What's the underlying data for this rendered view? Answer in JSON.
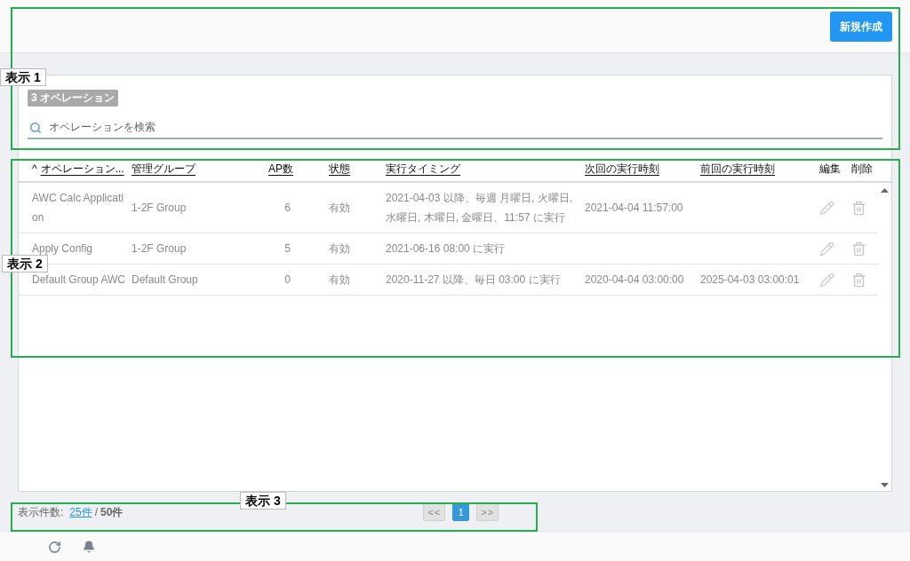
{
  "header": {
    "new_button": "新規作成"
  },
  "operations_panel": {
    "count_badge": "3 オペレーション",
    "search": {
      "placeholder": "オペレーションを検索"
    }
  },
  "table": {
    "columns": [
      {
        "label": "オペレーション...",
        "sortable": true,
        "sort_indicator": "^"
      },
      {
        "label": "管理グループ",
        "sortable": true
      },
      {
        "label": "AP数",
        "sortable": true
      },
      {
        "label": "状態",
        "sortable": true
      },
      {
        "label": "実行タイミング",
        "sortable": true
      },
      {
        "label": "次回の実行時刻",
        "sortable": true
      },
      {
        "label": "前回の実行時刻",
        "sortable": true
      },
      {
        "label": "編集",
        "sortable": false
      },
      {
        "label": "削除",
        "sortable": false
      }
    ],
    "rows": [
      {
        "cells": [
          "AWC Calc Application",
          "1-2F Group",
          "6",
          "有効",
          "2021-04-03 以降、毎週 月曜日, 火曜日, 水曜日, 木曜日, 金曜日、11:57 に実行",
          "2021-04-04 11:57:00",
          ""
        ]
      },
      {
        "cells": [
          "Apply Config",
          "1-2F Group",
          "5",
          "有効",
          "2021-06-16 08:00 に実行",
          "",
          ""
        ]
      },
      {
        "cells": [
          "Default Group AWC",
          "Default Group",
          "0",
          "有効",
          "2020-11-27 以降、毎日 03:00 に実行",
          "2020-04-04 03:00:00",
          "2025-04-03 03:00:01"
        ]
      }
    ]
  },
  "footer": {
    "page_size_label": "表示件数:",
    "page_size": "25件",
    "separator": "/",
    "total": "50件",
    "pagination": [
      {
        "label": "<<",
        "kind": "nav",
        "selected": false
      },
      {
        "label": "1",
        "kind": "page",
        "selected": true
      },
      {
        "label": ">>",
        "kind": "nav",
        "selected": false
      }
    ]
  },
  "annotations": [
    {
      "label": "表示 1"
    },
    {
      "label": "表示 2"
    },
    {
      "label": "表示 3"
    }
  ]
}
